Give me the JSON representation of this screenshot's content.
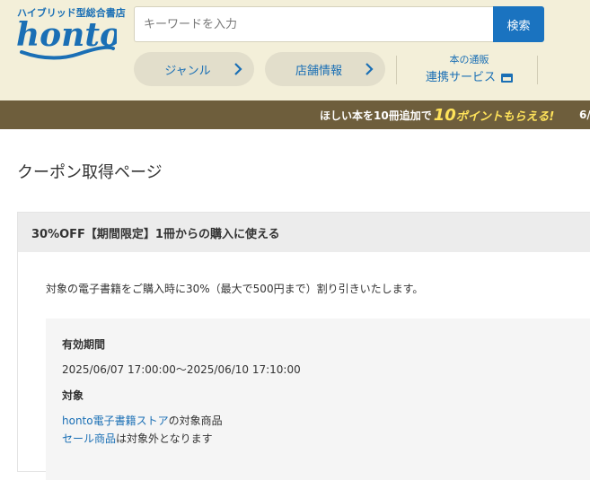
{
  "header": {
    "tagline": "ハイブリッド型総合書店",
    "logo_text": "honto",
    "search": {
      "placeholder": "キーワードを入力",
      "button_label": "検索"
    },
    "nav": {
      "genre_label": "ジャンル",
      "store_label": "店舗情報",
      "renkei_top": "本の通販",
      "renkei_main": "連携サービス"
    }
  },
  "banner": {
    "prefix": "ほしい本を10冊追加で",
    "highlight_num": "10",
    "highlight_text": "ポイントもらえる!",
    "next_text": "6/"
  },
  "main": {
    "page_title": "クーポン取得ページ",
    "coupon": {
      "title": "30%OFF【期間限定】1冊からの購入に使える",
      "description": "対象の電子書籍をご購入時に30%（最大で500円まで）割り引きいたします。",
      "validity_label": "有効期間",
      "validity_value": "2025/06/07 17:00:00～2025/06/10 17:10:00",
      "target_label": "対象",
      "target_link": "honto電子書籍ストア",
      "target_suffix": "の対象商品",
      "sale_link": "セール商品",
      "sale_suffix": "は対象外となります"
    }
  },
  "colors": {
    "header_bg": "#f3efd9",
    "brand_blue": "#1a6fb5",
    "banner_bg": "#6e5e3c",
    "banner_highlight": "#ffe35a"
  }
}
